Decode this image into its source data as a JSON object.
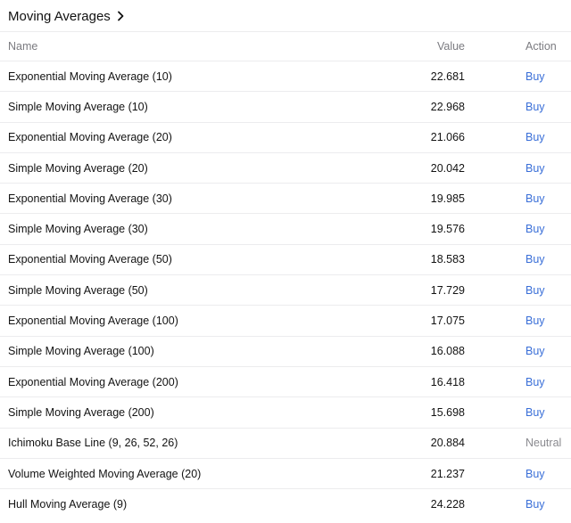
{
  "header": {
    "title": "Moving Averages"
  },
  "columns": {
    "name": "Name",
    "value": "Value",
    "action": "Action"
  },
  "colors": {
    "buy": "#3a6fd8",
    "neutral": "#8a8a8f",
    "divider": "#ececee"
  },
  "rows": [
    {
      "name": "Exponential Moving Average (10)",
      "value": "22.681",
      "action": "Buy"
    },
    {
      "name": "Simple Moving Average (10)",
      "value": "22.968",
      "action": "Buy"
    },
    {
      "name": "Exponential Moving Average (20)",
      "value": "21.066",
      "action": "Buy"
    },
    {
      "name": "Simple Moving Average (20)",
      "value": "20.042",
      "action": "Buy"
    },
    {
      "name": "Exponential Moving Average (30)",
      "value": "19.985",
      "action": "Buy"
    },
    {
      "name": "Simple Moving Average (30)",
      "value": "19.576",
      "action": "Buy"
    },
    {
      "name": "Exponential Moving Average (50)",
      "value": "18.583",
      "action": "Buy"
    },
    {
      "name": "Simple Moving Average (50)",
      "value": "17.729",
      "action": "Buy"
    },
    {
      "name": "Exponential Moving Average (100)",
      "value": "17.075",
      "action": "Buy"
    },
    {
      "name": "Simple Moving Average (100)",
      "value": "16.088",
      "action": "Buy"
    },
    {
      "name": "Exponential Moving Average (200)",
      "value": "16.418",
      "action": "Buy"
    },
    {
      "name": "Simple Moving Average (200)",
      "value": "15.698",
      "action": "Buy"
    },
    {
      "name": "Ichimoku Base Line (9, 26, 52, 26)",
      "value": "20.884",
      "action": "Neutral"
    },
    {
      "name": "Volume Weighted Moving Average (20)",
      "value": "21.237",
      "action": "Buy"
    },
    {
      "name": "Hull Moving Average (9)",
      "value": "24.228",
      "action": "Buy"
    }
  ]
}
